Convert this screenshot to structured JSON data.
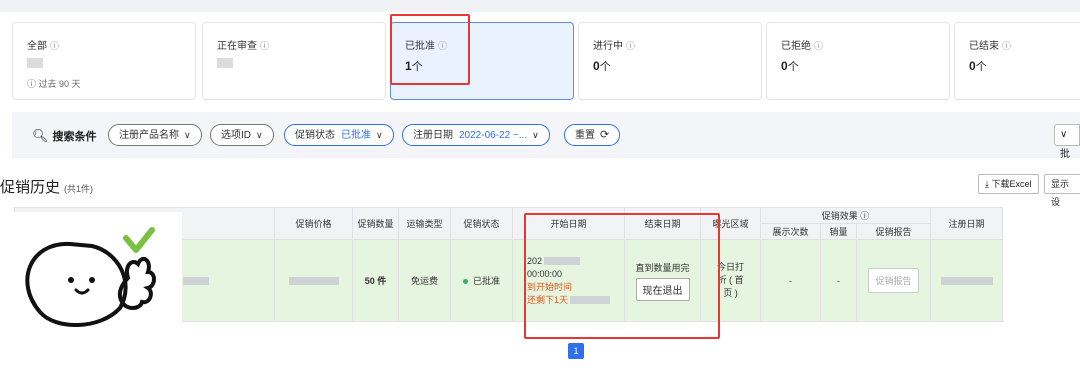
{
  "cards": [
    {
      "title": "全部",
      "info": "ⓘ",
      "value": "",
      "unit": "",
      "sub": "ⓘ 过去 90 天"
    },
    {
      "title": "正在审查",
      "info": "ⓘ",
      "value": "",
      "unit": ""
    },
    {
      "title": "已批准",
      "info": "ⓘ",
      "value": "1",
      "unit": "个"
    },
    {
      "title": "进行中",
      "info": "ⓘ",
      "value": "0",
      "unit": "个"
    },
    {
      "title": "已拒绝",
      "info": "ⓘ",
      "value": "0",
      "unit": "个"
    },
    {
      "title": "已结束",
      "info": "ⓘ",
      "value": "0",
      "unit": "个"
    }
  ],
  "filters": {
    "search_label": "搜索条件",
    "product": "注册产品名称",
    "option_id": "选项ID",
    "status_label": "促销状态",
    "status_value": "已批准",
    "date_label": "注册日期",
    "date_value": "2022-06-22 ~...",
    "reset": "重置",
    "reset_icon": "⟳",
    "right_btn": "∨ 批"
  },
  "history": {
    "title": "促销历史",
    "count": "(共1件)",
    "excel_btn": "⤓ 下载Excel",
    "display_btn": "显示设"
  },
  "table": {
    "headers": {
      "price": "促销价格",
      "qty": "促销数量",
      "ship": "运输类型",
      "status": "促销状态",
      "start": "开始日期",
      "end": "结束日期",
      "area": "曝光区域",
      "effect": "促销效果 ⓘ",
      "views": "展示次数",
      "sales": "销量",
      "report": "促销报告",
      "reg": "注册日期"
    },
    "row": {
      "qty": "50 件",
      "ship": "免运费",
      "status": "已批准",
      "start_l1": "202",
      "start_l2": "00:00:00",
      "start_l3": "到开始时间",
      "start_l4": "还剩下1天",
      "end_text": "直到数量用完",
      "quit_btn": "现在退出",
      "area_l1": "今日打",
      "area_l2": "折 ( 首",
      "area_l3": "页 )",
      "views": "-",
      "sales": "-",
      "report_btn": "促销报告"
    }
  },
  "pagination": {
    "current": "1"
  },
  "colors": {
    "accent": "#2f6fed",
    "highlight": "#e53935",
    "row_bg": "#e6f5df",
    "approved_dot": "#2db55d"
  }
}
